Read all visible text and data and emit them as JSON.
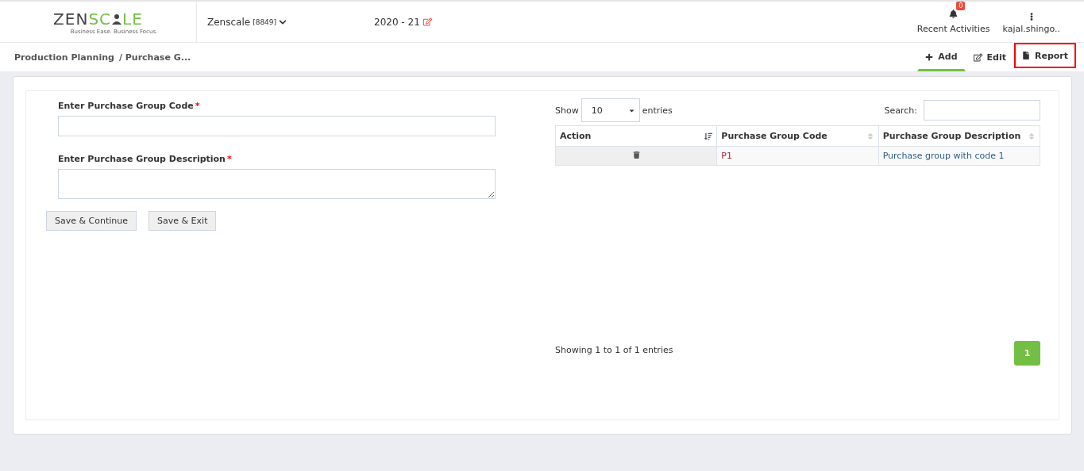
{
  "logo": {
    "parts": [
      "ZEN",
      "SC",
      "LE"
    ],
    "tagline": "Business Ease. Business Focus."
  },
  "company": {
    "name": "Zenscale",
    "code": "[8849]"
  },
  "year": "2020 - 21",
  "notifications": {
    "count": "0",
    "label": "Recent Activities"
  },
  "user": "kajal.shingo..",
  "breadcrumb": [
    "Production Planning",
    "/ Purchase G..."
  ],
  "tabs": [
    {
      "label": "Add",
      "kind": "add",
      "selected": true,
      "highlighted": false
    },
    {
      "label": "Edit",
      "kind": "edit",
      "selected": false,
      "highlighted": false
    },
    {
      "label": "Report",
      "kind": "report",
      "selected": false,
      "highlighted": true
    }
  ],
  "form": {
    "fields": [
      {
        "label": "Enter Purchase Group Code",
        "required": "*",
        "kind": "input"
      },
      {
        "label": "Enter Purchase Group Description",
        "required": "*",
        "kind": "textarea"
      }
    ],
    "buttons": [
      "Save & Continue",
      "Save & Exit"
    ]
  },
  "table": {
    "show_label": "Show",
    "page_size": "10",
    "entries_label": "entries",
    "search_label": "Search:",
    "columns": [
      {
        "label": "Action",
        "sorted": true
      },
      {
        "label": "Purchase Group Code",
        "sorted": false
      },
      {
        "label": "Purchase Group Description",
        "sorted": false
      }
    ],
    "rows": [
      {
        "code": "P1",
        "description": "Purchase group with code 1"
      }
    ],
    "info": "Showing 1 to 1 of 1 entries",
    "pages": [
      {
        "label": "1",
        "selected": true
      }
    ]
  }
}
